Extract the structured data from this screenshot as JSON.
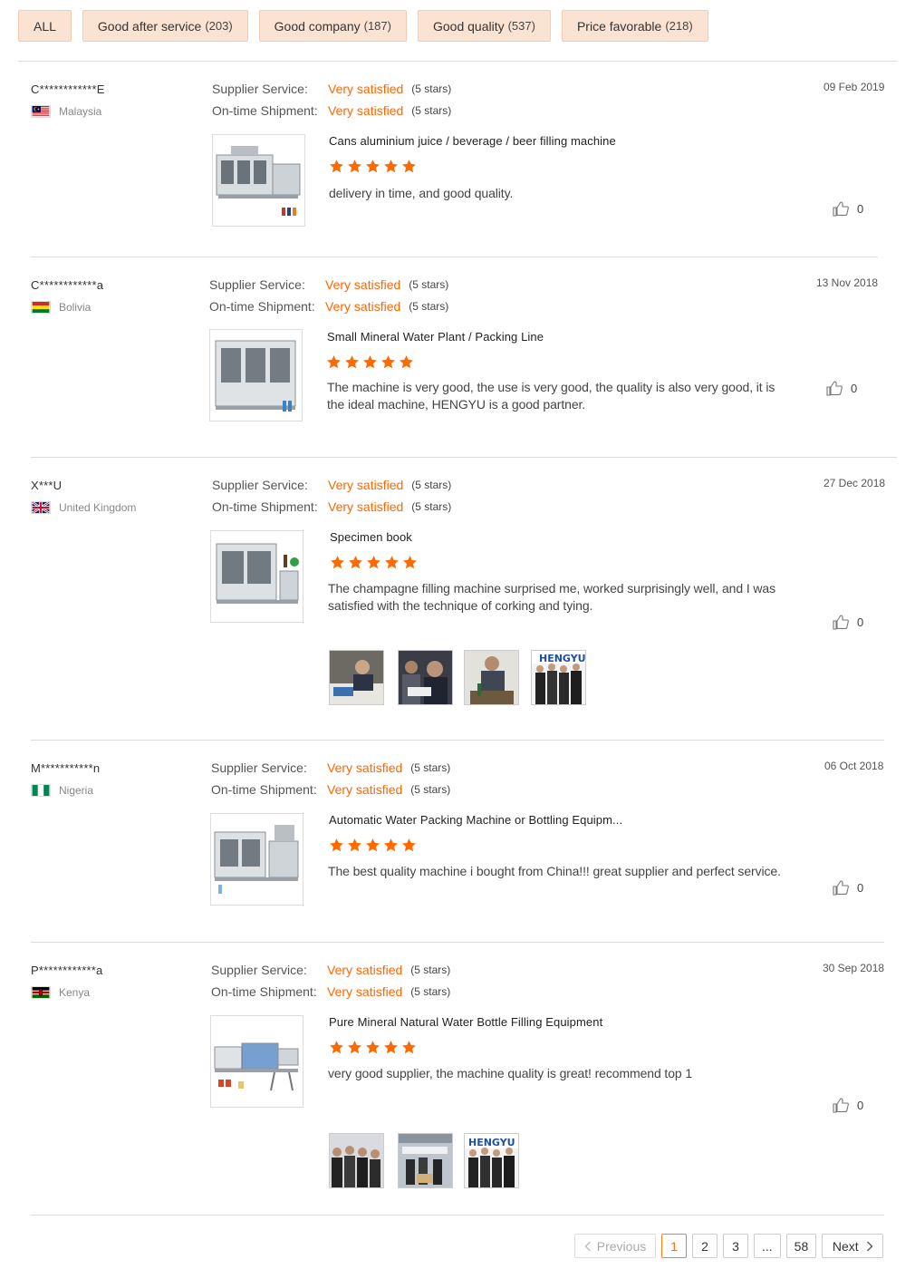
{
  "filters": [
    {
      "label": "ALL",
      "count": ""
    },
    {
      "label": "Good after service",
      "count": "(203)"
    },
    {
      "label": "Good company",
      "count": "(187)"
    },
    {
      "label": "Good quality",
      "count": "(537)"
    },
    {
      "label": "Price favorable",
      "count": "(218)"
    }
  ],
  "labels": {
    "supplier_service": "Supplier Service:",
    "ontime_shipment": "On-time Shipment:",
    "rating_value": "Very satisfied",
    "rating_stars": "(5 stars)"
  },
  "reviews": [
    {
      "name": "C************E",
      "country": "Malaysia",
      "flag": "malaysia-flag",
      "date": "09 Feb 2019",
      "product": "Cans aluminium juice / beverage / beer filling machine",
      "rating": 5,
      "comment": "delivery in time, and good quality.",
      "likes": "0",
      "photos": []
    },
    {
      "name": "C************a",
      "country": "Bolivia",
      "flag": "bolivia-flag",
      "date": "13 Nov 2018",
      "product": "Small Mineral Water Plant / Packing Line",
      "rating": 5,
      "comment": "The machine is very good, the use is very good, the quality is also very good, it is the ideal machine, HENGYU is a good partner.",
      "likes": "0",
      "photos": []
    },
    {
      "name": "X***U",
      "country": "United Kingdom",
      "flag": "uk-flag",
      "date": "27 Dec 2018",
      "product": "Specimen book",
      "rating": 5,
      "comment": "The champagne filling machine surprised me, worked surprisingly well, and I was satisfied with the technique of corking and tying.",
      "likes": "0",
      "photos": [
        "customer-photo-1",
        "customer-photo-2",
        "customer-photo-3",
        "customer-photo-4"
      ],
      "photo_caption": "HENGYU"
    },
    {
      "name": "M***********n",
      "country": "Nigeria",
      "flag": "nigeria-flag",
      "date": "06 Oct 2018",
      "product": "Automatic Water Packing Machine or Bottling Equipm...",
      "rating": 5,
      "comment": "The best quality machine i bought from China!!! great supplier and perfect service.",
      "likes": "0",
      "photos": []
    },
    {
      "name": "P************a",
      "country": "Kenya",
      "flag": "kenya-flag",
      "date": "30 Sep 2018",
      "product": "Pure Mineral Natural Water Bottle Filling Equipment",
      "rating": 5,
      "comment": "very good supplier, the machine quality is great! recommend top 1",
      "likes": "0",
      "photos": [
        "customer-photo-1",
        "customer-photo-2",
        "customer-photo-3"
      ],
      "photo_caption": "HENGYU"
    }
  ],
  "pagination": {
    "previous": "Previous",
    "pages": [
      "1",
      "2",
      "3",
      "...",
      "58"
    ],
    "current": "1",
    "next": "Next"
  },
  "colors": {
    "accent": "#ff6600",
    "tag_bg": "#fbe3d3",
    "star": "#ff6a00"
  }
}
